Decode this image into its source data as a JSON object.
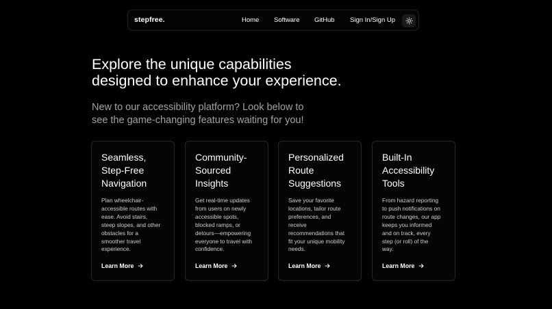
{
  "navbar": {
    "brand": "stepfree.",
    "links": [
      "Home",
      "Software",
      "GitHub",
      "Sign In/Sign Up"
    ],
    "theme_toggle_icon": "sun-icon"
  },
  "hero": {
    "title_lines": [
      "Explore the unique capabilities",
      "designed to enhance your experience."
    ],
    "subtitle_lines": [
      "New to our accessibility platform? Look below to",
      "see the game-changing features waiting for you!"
    ]
  },
  "cards": [
    {
      "title_lines": [
        "Seamless,",
        "Step-Free",
        "Navigation"
      ],
      "desc_lines": [
        "Plan wheelchair-",
        "accessible routes with",
        "ease. Avoid stairs,",
        "steep slopes, and other",
        "obstacles for a",
        "smoother travel",
        "experience."
      ],
      "link": "Learn More"
    },
    {
      "title_lines": [
        "Community-",
        "Sourced",
        "Insights"
      ],
      "desc_lines": [
        "Get real-time updates",
        "from users on newly",
        "accessible spots,",
        "blocked ramps, or",
        "detours—empowering",
        "everyone to travel with",
        "confidence."
      ],
      "link": "Learn More"
    },
    {
      "title_lines": [
        "Personalized",
        "Route",
        "Suggestions"
      ],
      "desc_lines": [
        "Save your favorite",
        "locations, tailor route",
        "preferences, and",
        "receive",
        "recommendations that",
        "fit your unique mobility",
        "needs."
      ],
      "link": "Learn More"
    },
    {
      "title_lines": [
        "Built-In",
        "Accessibility",
        "Tools"
      ],
      "desc_lines": [
        "From hazard reporting",
        "to push notifications on",
        "route changes, our app",
        "keeps you informed",
        "and on track, every",
        "step (or roll) of the",
        "way."
      ],
      "link": "Learn More"
    }
  ],
  "colors": {
    "background": "#000000",
    "card_border": "#262626",
    "subtitle": "#a3a3a3",
    "text": "#ffffff"
  }
}
